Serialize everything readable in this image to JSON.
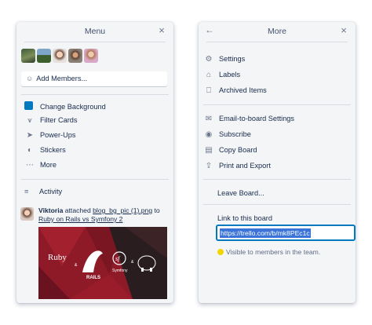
{
  "menu": {
    "title": "Menu",
    "close_icon": "×",
    "add_members_label": "Add Members...",
    "items": [
      {
        "label": "Change Background",
        "icon": "color-swatch"
      },
      {
        "label": "Filter Cards",
        "icon": "filter-icon"
      },
      {
        "label": "Power-Ups",
        "icon": "rocket-icon"
      },
      {
        "label": "Stickers",
        "icon": "sticker-icon"
      },
      {
        "label": "More",
        "icon": "ellipsis-icon"
      }
    ],
    "activity_label": "Activity",
    "activity": {
      "user": "Viktoria",
      "verb": "attached",
      "file": "blog_bg_pic (1).png",
      "prep": "to",
      "card": "Ruby on Rails vs Symfony 2"
    },
    "thumb": {
      "ruby": "Ruby",
      "rails": "RAILS",
      "sf": "sf",
      "symfony": "Symfony",
      "amp1": "&",
      "amp2": "&"
    },
    "swatch_color": "#0079bf"
  },
  "more": {
    "title": "More",
    "back_icon": "←",
    "close_icon": "×",
    "group1": [
      {
        "label": "Settings",
        "icon": "gear-icon"
      },
      {
        "label": "Labels",
        "icon": "tag-icon"
      },
      {
        "label": "Archived Items",
        "icon": "archive-icon"
      }
    ],
    "group2": [
      {
        "label": "Email-to-board Settings",
        "icon": "email-icon"
      },
      {
        "label": "Subscribe",
        "icon": "eye-icon"
      },
      {
        "label": "Copy Board",
        "icon": "copy-icon"
      },
      {
        "label": "Print and Export",
        "icon": "export-icon"
      }
    ],
    "leave_label": "Leave Board...",
    "link_label": "Link to this board",
    "link_url": "https://trello.com/b/mk8PEc1c",
    "visibility_note": "Visible to members in the team."
  }
}
